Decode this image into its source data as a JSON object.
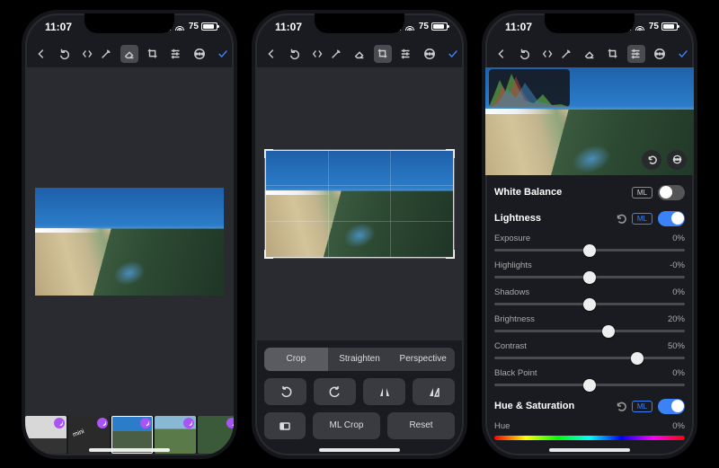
{
  "status": {
    "time": "11:07",
    "battery_pct": "75"
  },
  "toolbar_icons": {
    "back": "back-icon",
    "undo": "undo-icon",
    "code": "code-icon",
    "magicwand": "magic-wand-icon",
    "eraser": "eraser-icon",
    "crop": "crop-icon",
    "adjust": "sliders-icon",
    "more": "ellipsis-icon",
    "confirm": "checkmark-icon"
  },
  "phone2": {
    "tabs": {
      "crop": "Crop",
      "straighten": "Straighten",
      "perspective": "Perspective"
    },
    "icons": {
      "rotate_ccw": "rotate-ccw-icon",
      "rotate_cw": "rotate-cw-icon",
      "flip_h": "flip-horizontal-icon",
      "flip_v": "flip-vertical-icon",
      "aspect": "aspect-ratio-icon"
    },
    "mlcrop": "ML Crop",
    "reset": "Reset"
  },
  "phone3": {
    "float": {
      "reset": "reset-icon",
      "more": "ellipsis-icon"
    },
    "sections": {
      "wb": "White Balance",
      "lightness": "Lightness",
      "huesat": "Hue & Saturation"
    },
    "ml": "ML",
    "sliders": {
      "exposure": {
        "label": "Exposure",
        "value": "0%",
        "pos": 50
      },
      "highlights": {
        "label": "Highlights",
        "value": "-0%",
        "pos": 50
      },
      "shadows": {
        "label": "Shadows",
        "value": "0%",
        "pos": 50
      },
      "brightness": {
        "label": "Brightness",
        "value": "20%",
        "pos": 60
      },
      "contrast": {
        "label": "Contrast",
        "value": "50%",
        "pos": 75
      },
      "blackpoint": {
        "label": "Black Point",
        "value": "0%",
        "pos": 50
      },
      "hue": {
        "label": "Hue",
        "value": "0%",
        "pos": 50
      }
    }
  },
  "filmstrip": {
    "thumb2_text": "mini"
  }
}
